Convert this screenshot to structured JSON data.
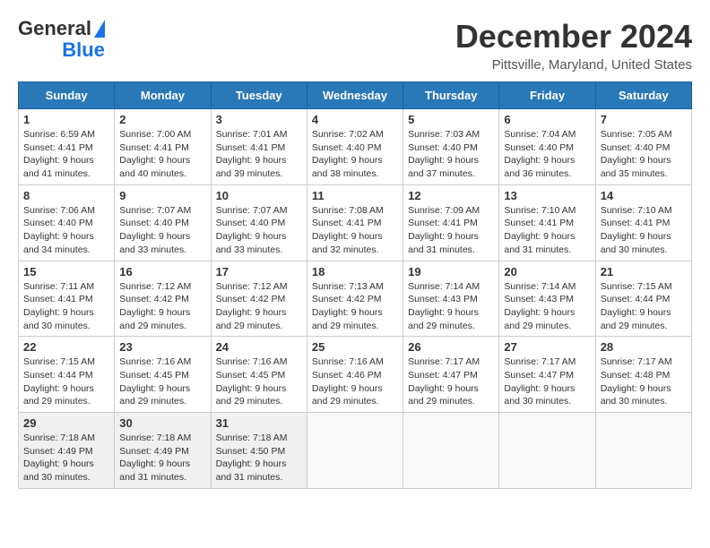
{
  "header": {
    "logo_line1": "General",
    "logo_line2": "Blue",
    "title": "December 2024",
    "subtitle": "Pittsville, Maryland, United States"
  },
  "calendar": {
    "days_of_week": [
      "Sunday",
      "Monday",
      "Tuesday",
      "Wednesday",
      "Thursday",
      "Friday",
      "Saturday"
    ],
    "weeks": [
      [
        {
          "day": "1",
          "sunrise": "6:59 AM",
          "sunset": "4:41 PM",
          "daylight": "9 hours and 41 minutes."
        },
        {
          "day": "2",
          "sunrise": "7:00 AM",
          "sunset": "4:41 PM",
          "daylight": "9 hours and 40 minutes."
        },
        {
          "day": "3",
          "sunrise": "7:01 AM",
          "sunset": "4:41 PM",
          "daylight": "9 hours and 39 minutes."
        },
        {
          "day": "4",
          "sunrise": "7:02 AM",
          "sunset": "4:40 PM",
          "daylight": "9 hours and 38 minutes."
        },
        {
          "day": "5",
          "sunrise": "7:03 AM",
          "sunset": "4:40 PM",
          "daylight": "9 hours and 37 minutes."
        },
        {
          "day": "6",
          "sunrise": "7:04 AM",
          "sunset": "4:40 PM",
          "daylight": "9 hours and 36 minutes."
        },
        {
          "day": "7",
          "sunrise": "7:05 AM",
          "sunset": "4:40 PM",
          "daylight": "9 hours and 35 minutes."
        }
      ],
      [
        {
          "day": "8",
          "sunrise": "7:06 AM",
          "sunset": "4:40 PM",
          "daylight": "9 hours and 34 minutes."
        },
        {
          "day": "9",
          "sunrise": "7:07 AM",
          "sunset": "4:40 PM",
          "daylight": "9 hours and 33 minutes."
        },
        {
          "day": "10",
          "sunrise": "7:07 AM",
          "sunset": "4:40 PM",
          "daylight": "9 hours and 33 minutes."
        },
        {
          "day": "11",
          "sunrise": "7:08 AM",
          "sunset": "4:41 PM",
          "daylight": "9 hours and 32 minutes."
        },
        {
          "day": "12",
          "sunrise": "7:09 AM",
          "sunset": "4:41 PM",
          "daylight": "9 hours and 31 minutes."
        },
        {
          "day": "13",
          "sunrise": "7:10 AM",
          "sunset": "4:41 PM",
          "daylight": "9 hours and 31 minutes."
        },
        {
          "day": "14",
          "sunrise": "7:10 AM",
          "sunset": "4:41 PM",
          "daylight": "9 hours and 30 minutes."
        }
      ],
      [
        {
          "day": "15",
          "sunrise": "7:11 AM",
          "sunset": "4:41 PM",
          "daylight": "9 hours and 30 minutes."
        },
        {
          "day": "16",
          "sunrise": "7:12 AM",
          "sunset": "4:42 PM",
          "daylight": "9 hours and 29 minutes."
        },
        {
          "day": "17",
          "sunrise": "7:12 AM",
          "sunset": "4:42 PM",
          "daylight": "9 hours and 29 minutes."
        },
        {
          "day": "18",
          "sunrise": "7:13 AM",
          "sunset": "4:42 PM",
          "daylight": "9 hours and 29 minutes."
        },
        {
          "day": "19",
          "sunrise": "7:14 AM",
          "sunset": "4:43 PM",
          "daylight": "9 hours and 29 minutes."
        },
        {
          "day": "20",
          "sunrise": "7:14 AM",
          "sunset": "4:43 PM",
          "daylight": "9 hours and 29 minutes."
        },
        {
          "day": "21",
          "sunrise": "7:15 AM",
          "sunset": "4:44 PM",
          "daylight": "9 hours and 29 minutes."
        }
      ],
      [
        {
          "day": "22",
          "sunrise": "7:15 AM",
          "sunset": "4:44 PM",
          "daylight": "9 hours and 29 minutes."
        },
        {
          "day": "23",
          "sunrise": "7:16 AM",
          "sunset": "4:45 PM",
          "daylight": "9 hours and 29 minutes."
        },
        {
          "day": "24",
          "sunrise": "7:16 AM",
          "sunset": "4:45 PM",
          "daylight": "9 hours and 29 minutes."
        },
        {
          "day": "25",
          "sunrise": "7:16 AM",
          "sunset": "4:46 PM",
          "daylight": "9 hours and 29 minutes."
        },
        {
          "day": "26",
          "sunrise": "7:17 AM",
          "sunset": "4:47 PM",
          "daylight": "9 hours and 29 minutes."
        },
        {
          "day": "27",
          "sunrise": "7:17 AM",
          "sunset": "4:47 PM",
          "daylight": "9 hours and 30 minutes."
        },
        {
          "day": "28",
          "sunrise": "7:17 AM",
          "sunset": "4:48 PM",
          "daylight": "9 hours and 30 minutes."
        }
      ],
      [
        {
          "day": "29",
          "sunrise": "7:18 AM",
          "sunset": "4:49 PM",
          "daylight": "9 hours and 30 minutes."
        },
        {
          "day": "30",
          "sunrise": "7:18 AM",
          "sunset": "4:49 PM",
          "daylight": "9 hours and 31 minutes."
        },
        {
          "day": "31",
          "sunrise": "7:18 AM",
          "sunset": "4:50 PM",
          "daylight": "9 hours and 31 minutes."
        },
        null,
        null,
        null,
        null
      ]
    ]
  }
}
